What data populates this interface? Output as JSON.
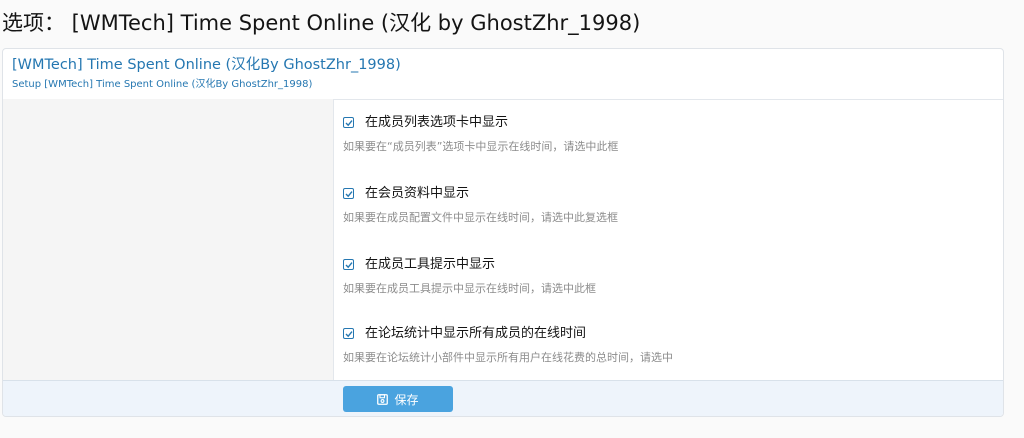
{
  "page": {
    "title": "选项： [WMTech] Time Spent Online (汉化 by GhostZhr_1998)"
  },
  "block": {
    "title": "[WMTech] Time Spent Online (汉化By GhostZhr_1998)",
    "description": "Setup [WMTech] Time Spent Online (汉化By GhostZhr_1998)"
  },
  "options": [
    {
      "label": "在成员列表选项卡中显示",
      "hint": "如果要在“成员列表”选项卡中显示在线时间，请选中此框",
      "checked": true
    },
    {
      "label": "在会员资料中显示",
      "hint": "如果要在成员配置文件中显示在线时间，请选中此复选框",
      "checked": true
    },
    {
      "label": "在成员工具提示中显示",
      "hint": "如果要在成员工具提示中显示在线时间，请选中此框",
      "checked": true
    },
    {
      "label": "在论坛统计中显示所有成员的在线时间",
      "hint": "如果要在论坛统计小部件中显示所有用户在线花费的总时间，请选中",
      "checked": true
    }
  ],
  "footer": {
    "save_label": "保存",
    "save_icon": "save-icon"
  },
  "colors": {
    "accent": "#2577b1",
    "button": "#4aa3df"
  }
}
